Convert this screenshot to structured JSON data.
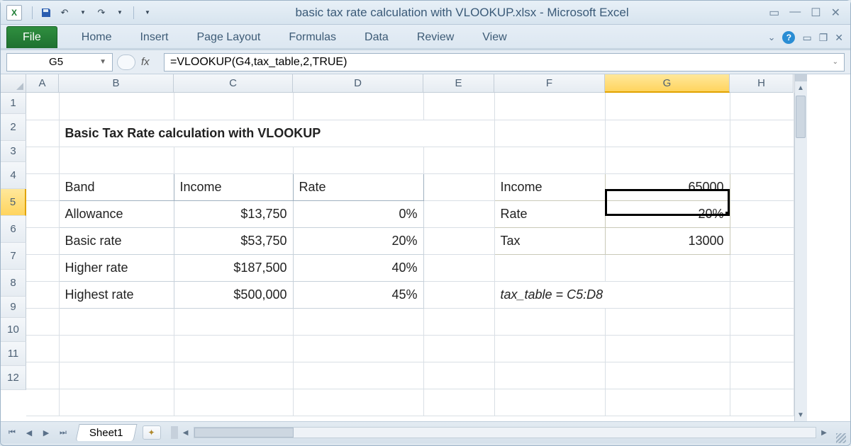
{
  "window": {
    "title": "basic tax rate calculation with VLOOKUP.xlsx  -  Microsoft Excel"
  },
  "ribbon": {
    "file": "File",
    "tabs": [
      "Home",
      "Insert",
      "Page Layout",
      "Formulas",
      "Data",
      "Review",
      "View"
    ]
  },
  "nameBox": "G5",
  "formula": "=VLOOKUP(G4,tax_table,2,TRUE)",
  "fxLabel": "fx",
  "columns": [
    "A",
    "B",
    "C",
    "D",
    "E",
    "F",
    "G",
    "H"
  ],
  "selectedColumn": "G",
  "rows": [
    "1",
    "2",
    "3",
    "4",
    "5",
    "6",
    "7",
    "8",
    "9",
    "10",
    "11",
    "12"
  ],
  "selectedRow": "5",
  "sheetTitle": "Basic Tax Rate calculation with VLOOKUP",
  "taxTable": {
    "headers": {
      "band": "Band",
      "income": "Income",
      "rate": "Rate"
    },
    "rows": [
      {
        "band": "Allowance",
        "income": "$13,750",
        "rate": "0%"
      },
      {
        "band": "Basic rate",
        "income": "$53,750",
        "rate": "20%"
      },
      {
        "band": "Higher rate",
        "income": "$187,500",
        "rate": "40%"
      },
      {
        "band": "Highest rate",
        "income": "$500,000",
        "rate": "45%"
      }
    ]
  },
  "calc": {
    "incomeLabel": "Income",
    "incomeValue": "65000",
    "rateLabel": "Rate",
    "rateValue": "20%",
    "taxLabel": "Tax",
    "taxValue": "13000"
  },
  "note": "tax_table = C5:D8",
  "sheetTab": "Sheet1",
  "chart_data": {
    "type": "table",
    "title": "Basic Tax Rate calculation with VLOOKUP",
    "columns": [
      "Band",
      "Income",
      "Rate"
    ],
    "rows": [
      [
        "Allowance",
        13750,
        0.0
      ],
      [
        "Basic rate",
        53750,
        0.2
      ],
      [
        "Higher rate",
        187500,
        0.4
      ],
      [
        "Highest rate",
        500000,
        0.45
      ]
    ],
    "lookup": {
      "income": 65000,
      "rate": 0.2,
      "tax": 13000
    },
    "named_range": "tax_table = C5:D8"
  }
}
